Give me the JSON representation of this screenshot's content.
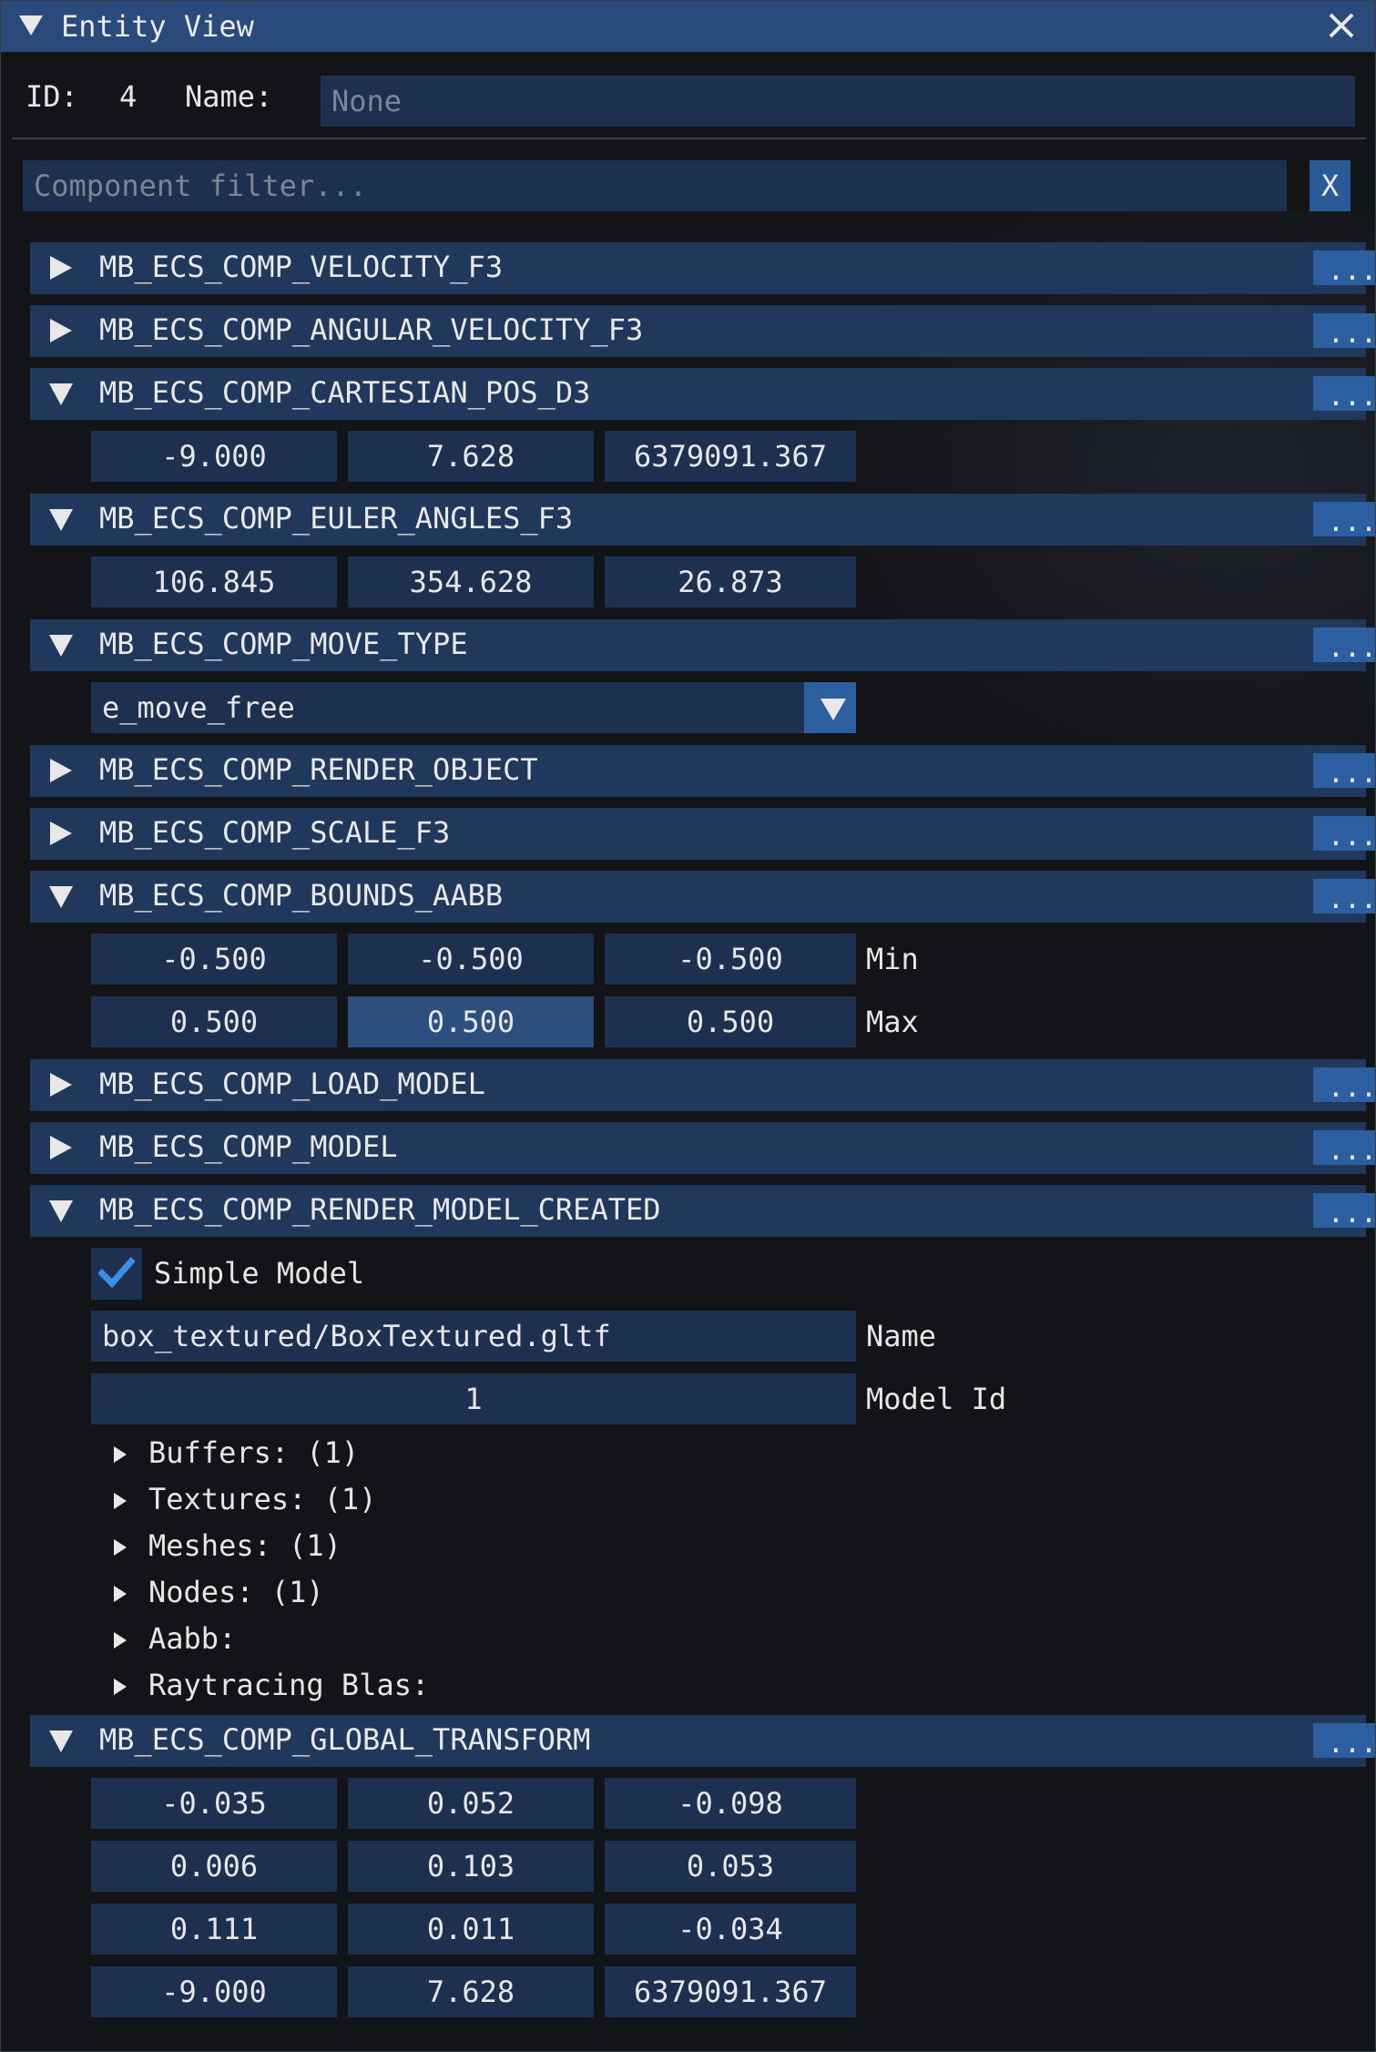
{
  "window": {
    "title": "Entity View"
  },
  "entity": {
    "id_label": "ID:",
    "id_value": "4",
    "name_label": "Name:",
    "name_placeholder": "None"
  },
  "filter": {
    "placeholder": "Component filter...",
    "clear_label": "X"
  },
  "components": {
    "velocity": {
      "title": "MB_ECS_COMP_VELOCITY_F3",
      "more": "..."
    },
    "angular_velocity": {
      "title": "MB_ECS_COMP_ANGULAR_VELOCITY_F3",
      "more": "..."
    },
    "cartesian_pos": {
      "title": "MB_ECS_COMP_CARTESIAN_POS_D3",
      "more": "...",
      "values": [
        "-9.000",
        "7.628",
        "6379091.367"
      ]
    },
    "euler_angles": {
      "title": "MB_ECS_COMP_EULER_ANGLES_F3",
      "more": "...",
      "values": [
        "106.845",
        "354.628",
        "26.873"
      ]
    },
    "move_type": {
      "title": "MB_ECS_COMP_MOVE_TYPE",
      "more": "...",
      "selected": "e_move_free"
    },
    "render_object": {
      "title": "MB_ECS_COMP_RENDER_OBJECT",
      "more": "..."
    },
    "scale": {
      "title": "MB_ECS_COMP_SCALE_F3",
      "more": "..."
    },
    "bounds": {
      "title": "MB_ECS_COMP_BOUNDS_AABB",
      "more": "...",
      "min": [
        "-0.500",
        "-0.500",
        "-0.500"
      ],
      "min_label": "Min",
      "max": [
        "0.500",
        "0.500",
        "0.500"
      ],
      "max_label": "Max"
    },
    "load_model": {
      "title": "MB_ECS_COMP_LOAD_MODEL",
      "more": "..."
    },
    "model": {
      "title": "MB_ECS_COMP_MODEL",
      "more": "..."
    },
    "render_model_created": {
      "title": "MB_ECS_COMP_RENDER_MODEL_CREATED",
      "more": "...",
      "simple_model_label": "Simple Model",
      "name_value": "box_textured/BoxTextured.gltf",
      "name_label": "Name",
      "model_id_value": "1",
      "model_id_label": "Model Id",
      "tree": [
        "Buffers: (1)",
        "Textures: (1)",
        "Meshes: (1)",
        "Nodes: (1)",
        "Aabb:",
        "Raytracing Blas:"
      ]
    },
    "global_transform": {
      "title": "MB_ECS_COMP_GLOBAL_TRANSFORM",
      "more": "...",
      "rows": [
        [
          "-0.035",
          "0.052",
          "-0.098"
        ],
        [
          "0.006",
          "0.103",
          "0.053"
        ],
        [
          "0.111",
          "0.011",
          "-0.034"
        ],
        [
          "-9.000",
          "7.628",
          "6379091.367"
        ]
      ]
    }
  }
}
